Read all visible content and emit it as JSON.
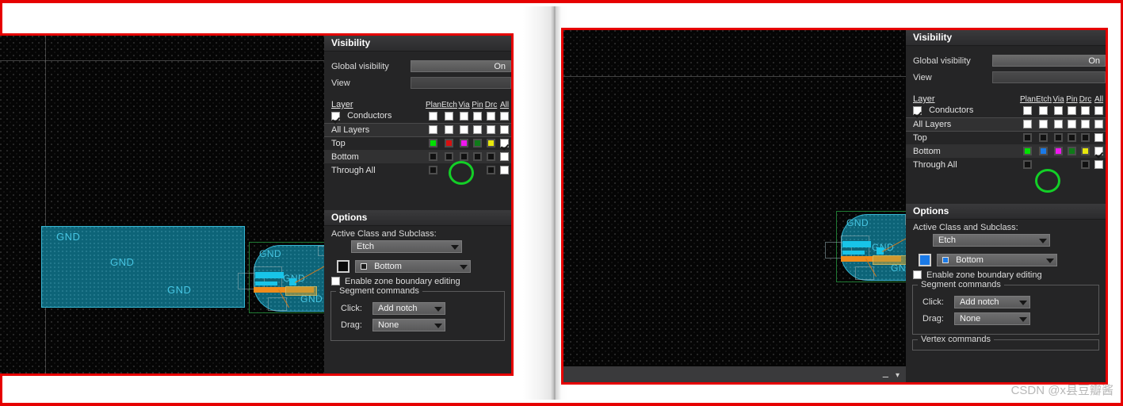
{
  "watermark": "CSDN @x县豆瓣酱",
  "panel": {
    "visibility_title": "Visibility",
    "options_title": "Options",
    "global_visibility_label": "Global visibility",
    "global_visibility_value": "On",
    "view_label": "View",
    "view_value": "",
    "layer_header": "Layer",
    "columns": [
      "Plan",
      "Etch",
      "Via",
      "Pin",
      "Drc",
      "All"
    ],
    "rows": {
      "conductors": "Conductors",
      "all_layers": "All Layers",
      "top": "Top",
      "bottom": "Bottom",
      "through_all": "Through All"
    },
    "options": {
      "active_class_label": "Active Class and Subclass:",
      "class_value": "Etch",
      "subclass_value": "Bottom",
      "enable_zone_label": "Enable zone boundary editing",
      "segment_commands_legend": "Segment commands",
      "click_label": "Click:",
      "click_value": "Add notch",
      "drag_label": "Drag:",
      "drag_value": "None",
      "vertex_commands_legend": "Vertex commands"
    }
  },
  "left_shot": {
    "top_row_colors": [
      "#00e000",
      "#d81010",
      "#ef17ef",
      "#0f7a19",
      "#e8e80d"
    ],
    "bottom_row_colors": [
      "#111111",
      "#111111",
      "#111111",
      "#111111",
      "#111111"
    ],
    "through_all_colors": [
      "#111111",
      "#111111"
    ],
    "highlight_target": "top-all-checkbox",
    "subclass_swatch": "#0b0b0b",
    "subclass_inner_swatch": "#1a1a1a",
    "checked": {
      "top_all": true,
      "bottom_all": false,
      "through_all": false
    }
  },
  "right_shot": {
    "top_row_colors": [
      "#111111",
      "#111111",
      "#111111",
      "#111111",
      "#111111"
    ],
    "bottom_row_colors": [
      "#00e000",
      "#1a7ae8",
      "#ef17ef",
      "#0f7a19",
      "#e8e80d"
    ],
    "through_all_colors": [
      "#111111",
      "#111111"
    ],
    "highlight_target": "bottom-all-checkbox",
    "subclass_swatch": "#1a7ae8",
    "subclass_inner_swatch": "#1a7ae8",
    "checked": {
      "top_all": false,
      "bottom_all": true,
      "through_all": false
    }
  },
  "canvas": {
    "net_label": "GND",
    "background": "#050505",
    "pour_fill": "#0d6478",
    "pour_border": "#37b7d4",
    "trace_cyan": "#18c4e8",
    "trace_orange": "#ef8b1b"
  }
}
